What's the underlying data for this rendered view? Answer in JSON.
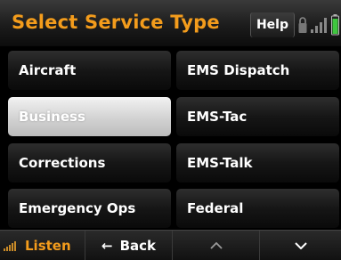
{
  "header": {
    "title": "Select Service Type",
    "help_label": "Help"
  },
  "services": [
    {
      "label": "Aircraft"
    },
    {
      "label": "EMS Dispatch"
    },
    {
      "label": "Business",
      "selected": true
    },
    {
      "label": "EMS-Tac"
    },
    {
      "label": "Corrections"
    },
    {
      "label": "EMS-Talk"
    },
    {
      "label": "Emergency Ops"
    },
    {
      "label": "Federal"
    }
  ],
  "bottom_bar": {
    "listen_label": "Listen",
    "back_label": "Back",
    "back_arrow": "←",
    "up_glyph": "⌃",
    "down_glyph": "⌄"
  },
  "colors": {
    "accent": "#f39c1c",
    "selected_bg": "#d2d2d2",
    "button_bg": "#161616"
  },
  "icons": [
    "lock-icon",
    "signal-icon",
    "battery-icon",
    "speaker-icon",
    "back-arrow-icon",
    "chevron-up-icon",
    "chevron-down-icon"
  ]
}
